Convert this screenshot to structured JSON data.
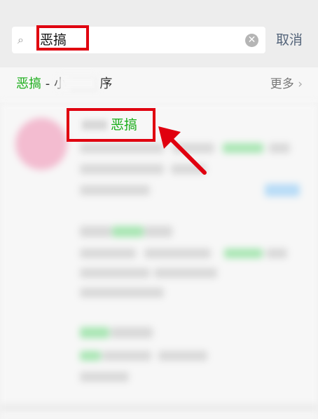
{
  "search": {
    "query": "恶搞",
    "cancel_label": "取消"
  },
  "section": {
    "keyword": "恶搞",
    "rest": " - 小",
    "suffix": "序",
    "more_label": "更多"
  },
  "result": {
    "title_keyword": "恶搞"
  },
  "colors": {
    "accent_green": "#1aad19",
    "highlight_red": "#e0000f",
    "cancel_blue": "#54647a"
  },
  "icons": {
    "search": "search-icon",
    "clear": "clear-icon",
    "chevron": "chevron-right-icon"
  }
}
